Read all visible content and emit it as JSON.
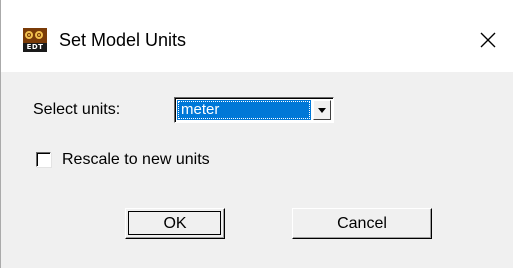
{
  "window": {
    "title": "Set Model Units",
    "app_icon": "edt-app-icon",
    "app_icon_text": "EDT",
    "close_icon": "close-icon"
  },
  "form": {
    "select_label": "Select units:",
    "units_value": "meter",
    "units_dropdown_icon": "chevron-down-icon",
    "rescale_label": "Rescale to new units",
    "rescale_checked": false
  },
  "buttons": {
    "ok_label": "OK",
    "cancel_label": "Cancel"
  },
  "colors": {
    "selection": "#0078d7",
    "dialog_background": "#f0f0f0",
    "titlebar_background": "#ffffff"
  }
}
